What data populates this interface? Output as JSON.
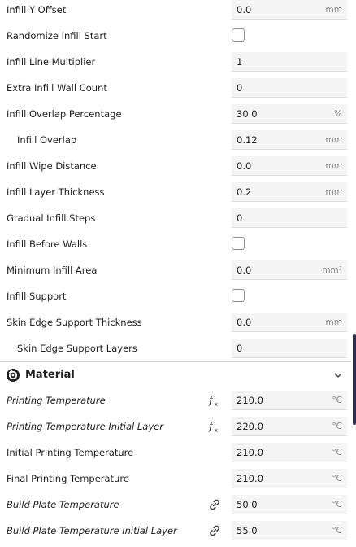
{
  "settings_upper": [
    {
      "label": "Infill Y Offset",
      "value": "0.0",
      "unit": "mm"
    },
    {
      "label": "Randomize Infill Start",
      "checkbox": true
    },
    {
      "label": "Infill Line Multiplier",
      "value": "1",
      "unit": ""
    },
    {
      "label": "Extra Infill Wall Count",
      "value": "0",
      "unit": ""
    },
    {
      "label": "Infill Overlap Percentage",
      "value": "30.0",
      "unit": "%"
    },
    {
      "label": "Infill Overlap",
      "value": "0.12",
      "unit": "mm",
      "indent": true
    },
    {
      "label": "Infill Wipe Distance",
      "value": "0.0",
      "unit": "mm"
    },
    {
      "label": "Infill Layer Thickness",
      "value": "0.2",
      "unit": "mm"
    },
    {
      "label": "Gradual Infill Steps",
      "value": "0",
      "unit": ""
    },
    {
      "label": "Infill Before Walls",
      "checkbox": true
    },
    {
      "label": "Minimum Infill Area",
      "value": "0.0",
      "unit": "mm²"
    },
    {
      "label": "Infill Support",
      "checkbox": true
    },
    {
      "label": "Skin Edge Support Thickness",
      "value": "0.0",
      "unit": "mm"
    },
    {
      "label": "Skin Edge Support Layers",
      "value": "0",
      "unit": "",
      "indent": true
    }
  ],
  "material_section": {
    "title": "Material",
    "icon": "material-spool-icon",
    "chevron": "chevron-down-icon"
  },
  "settings_material": [
    {
      "label": "Printing Temperature",
      "value": "210.0",
      "unit": "°C",
      "italic": true,
      "icon": "function-icon"
    },
    {
      "label": "Printing Temperature Initial Layer",
      "value": "220.0",
      "unit": "°C",
      "italic": true,
      "icon": "function-icon"
    },
    {
      "label": "Initial Printing Temperature",
      "value": "210.0",
      "unit": "°C"
    },
    {
      "label": "Final Printing Temperature",
      "value": "210.0",
      "unit": "°C"
    },
    {
      "label": "Build Plate Temperature",
      "value": "50.0",
      "unit": "°C",
      "italic": true,
      "icon": "link-icon"
    },
    {
      "label": "Build Plate Temperature Initial Layer",
      "value": "55.0",
      "unit": "°C",
      "italic": true,
      "icon": "link-icon"
    }
  ]
}
